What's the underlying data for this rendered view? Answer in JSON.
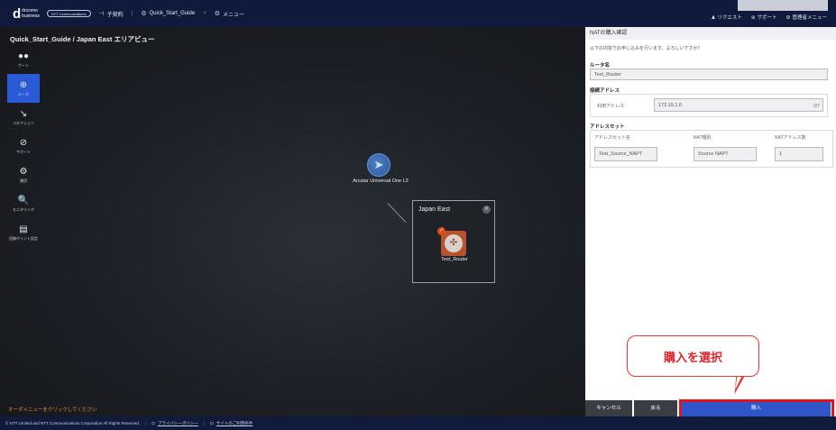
{
  "header": {
    "logo_main": "d",
    "logo_line1": "docomo",
    "logo_line2": "business",
    "partner_logo": "NTT Communications",
    "nav": [
      {
        "icon": "⊣",
        "label": "子契約"
      },
      {
        "icon": "⚙",
        "label": "Quick_Start_Guide"
      },
      {
        "icon": "⚙",
        "label": "メニュー"
      }
    ],
    "nav_sep": ">",
    "right": [
      {
        "icon": "♟",
        "label": "リクエスト"
      },
      {
        "icon": "⊛",
        "label": "サポート"
      },
      {
        "icon": "⚙",
        "label": "管理者メニュー"
      }
    ]
  },
  "canvas": {
    "title": "Quick_Start_Guide / Japan East エリアビュー",
    "sidebar": [
      {
        "icon": "●●",
        "label": "ゲート",
        "active": false
      },
      {
        "icon": "⊕",
        "label": "ルータ",
        "active": true
      },
      {
        "icon": "↘",
        "label": "コネクション",
        "active": false
      },
      {
        "icon": "⊘",
        "label": "サポート",
        "active": false
      },
      {
        "icon": "⚙",
        "label": "運用",
        "active": false
      },
      {
        "icon": "🔍",
        "label": "モニタリング",
        "active": false
      },
      {
        "icon": "▤",
        "label": "回線ポイント設定",
        "active": false
      }
    ],
    "hint": "オーダメニューをクリックしてください",
    "network_node": "Arcstar Universal One L3",
    "area": {
      "title": "Japan East",
      "close": "✕"
    },
    "router": {
      "label": "Test_Router",
      "check": "✓"
    }
  },
  "panel": {
    "title": "NATの購入確認",
    "confirm": "以下の内容でお申し込みを行います。よろしいですか？",
    "router_name_label": "ルータ名",
    "router_name_value": "Test_Router",
    "connect_address_label": "接続アドレス",
    "available_address_label": "利用アドレス",
    "available_address_value": "172.19.1.0",
    "available_address_suffix": "/27",
    "address_set_label": "アドレスセット",
    "col_name": "アドレスセット名",
    "col_type": "NAT種別",
    "col_count": "NATアドレス数",
    "set_name_value": "Test_Source_NAPT",
    "set_type_value": "Source NAPT",
    "set_count_value": "1"
  },
  "buttons": {
    "cancel": "キャンセル",
    "back": "戻る",
    "buy": "購入"
  },
  "annotation": "購入を選択",
  "footer": {
    "copyright": "© NTT Limited and NTT Communications Corporation All Rights Reserved.",
    "links": [
      {
        "icon": "⊡",
        "label": "プライバシーポリシー"
      },
      {
        "icon": "⊡",
        "label": "サイトのご利用条件"
      }
    ]
  }
}
